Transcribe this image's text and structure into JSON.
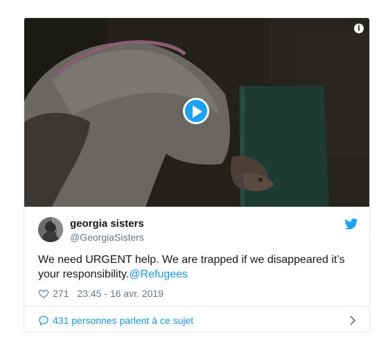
{
  "tweet": {
    "display_name": "georgia sisters",
    "handle": "@GeorgiaSisters",
    "text_main": "We need URGENT help. We are trapped if we disappeared it’s your responsibility.",
    "mention": "@Refugees",
    "likes": "271",
    "timestamp": "23:45 - 16 avr. 2019",
    "conversation_label": "431 personnes parlent à ce sujet"
  },
  "media": {
    "info_symbol": "i",
    "type": "video"
  },
  "icons": {
    "info": "info-icon",
    "play": "play-icon",
    "bird": "twitter-bird-icon",
    "heart": "heart-icon",
    "bubble": "speech-bubble-icon",
    "chevron": "chevron-right-icon"
  },
  "colors": {
    "accent": "#1da1f2",
    "link": "#1b95e0",
    "muted": "#657786",
    "border": "#e1e8ed"
  }
}
